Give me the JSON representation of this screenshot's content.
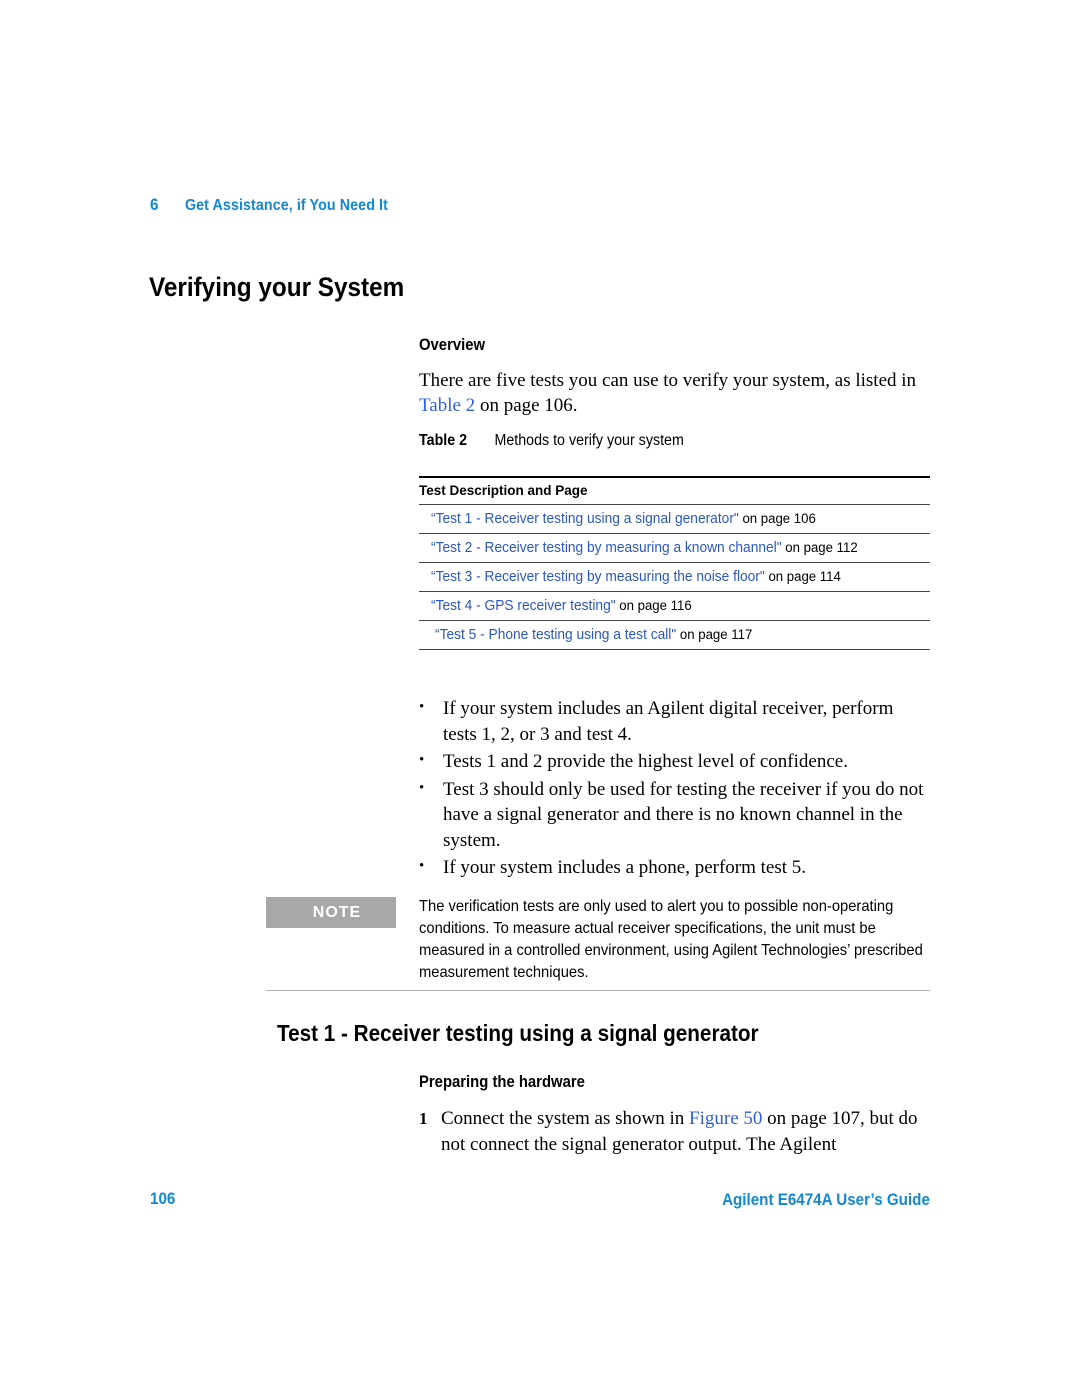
{
  "colors": {
    "agilent_blue": "#1387cf",
    "xref_blue": "#2f5fd8",
    "table_link_blue": "#2b57c4",
    "note_badge_gray": "#a8a8a8",
    "rule_black": "#000000",
    "note_rule_gray": "#b5b5b5"
  },
  "running_header": {
    "chapter_number": "6",
    "chapter_title": "Get Assistance, if You Need It"
  },
  "page_title": "Verifying your System",
  "overview": {
    "heading": "Overview",
    "paragraph_part1": "There are five tests you can use to verify your system, as listed in ",
    "paragraph_xref": "Table 2",
    "paragraph_part2": " on page 106."
  },
  "table": {
    "caption_label": "Table 2",
    "caption_text": "Methods to verify your system",
    "column_header": "Test Description and Page",
    "rows": [
      {
        "link": "“Test 1 - Receiver testing using a signal generator\"",
        "page_text": " on page 106"
      },
      {
        "link": "“Test 2 - Receiver testing by measuring a known channel\"",
        "page_text": " on page 112"
      },
      {
        "link": "“Test 3 - Receiver testing by measuring the noise floor\"",
        "page_text": " on page 114"
      },
      {
        "link": "“Test 4 - GPS receiver testing\"",
        "page_text": " on page 116"
      },
      {
        "link": "“Test 5 - Phone testing using a test call\"",
        "page_text": " on page 117"
      }
    ]
  },
  "bullets": [
    "If your system includes an Agilent digital receiver, perform tests 1, 2, or 3 and test 4.",
    "Tests 1 and 2 provide the highest level of confidence.",
    "Test 3 should only be used for testing the receiver if you do not have a signal generator and there is no known channel in the system.",
    "If your system includes a phone, perform test 5."
  ],
  "note": {
    "badge_label": "NOTE",
    "text": "The verification tests are only used to alert you to possible non-operating conditions. To measure actual receiver specifications, the unit must be measured in a controlled environment, using Agilent Technologies’ prescribed measurement techniques."
  },
  "test1": {
    "heading": "Test 1 - Receiver testing using a signal generator",
    "subheading": "Preparing the hardware",
    "step1_number": "1",
    "step1_part1": "Connect the system as shown in ",
    "step1_xref": "Figure 50",
    "step1_part2": " on page 107, but do not connect the signal generator output. The Agilent"
  },
  "footer": {
    "page_number": "106",
    "guide_title": "Agilent E6474A User’s Guide"
  }
}
